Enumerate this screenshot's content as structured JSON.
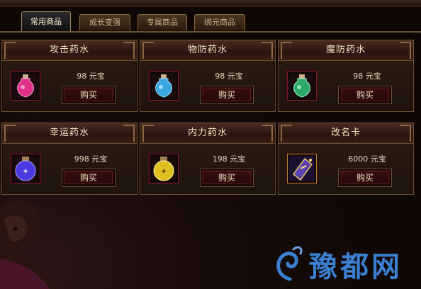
{
  "tabs": [
    {
      "label": "常用商品",
      "active": true
    },
    {
      "label": "成长变强",
      "active": false
    },
    {
      "label": "专属商品",
      "active": false
    },
    {
      "label": "绑元商品",
      "active": false
    }
  ],
  "items": [
    {
      "name": "攻击药水",
      "price": "98 元宝",
      "buy_label": "购买",
      "icon": "pink-potion-icon",
      "color": "#e0308a"
    },
    {
      "name": "物防药水",
      "price": "98 元宝",
      "buy_label": "购买",
      "icon": "blue-potion-icon",
      "color": "#3aa8e0"
    },
    {
      "name": "魔防药水",
      "price": "98 元宝",
      "buy_label": "购买",
      "icon": "green-potion-icon",
      "color": "#2ea86a"
    },
    {
      "name": "幸运药水",
      "price": "998 元宝",
      "buy_label": "购买",
      "icon": "purple-potion-icon",
      "color": "#4a3ae0"
    },
    {
      "name": "内力药水",
      "price": "198 元宝",
      "buy_label": "购买",
      "icon": "yellow-potion-icon",
      "color": "#e0c020"
    },
    {
      "name": "改名卡",
      "price": "6000 元宝",
      "buy_label": "购买",
      "icon": "rename-card-icon",
      "color": "#7a5ad0"
    }
  ],
  "watermark": {
    "text": "豫都网"
  }
}
